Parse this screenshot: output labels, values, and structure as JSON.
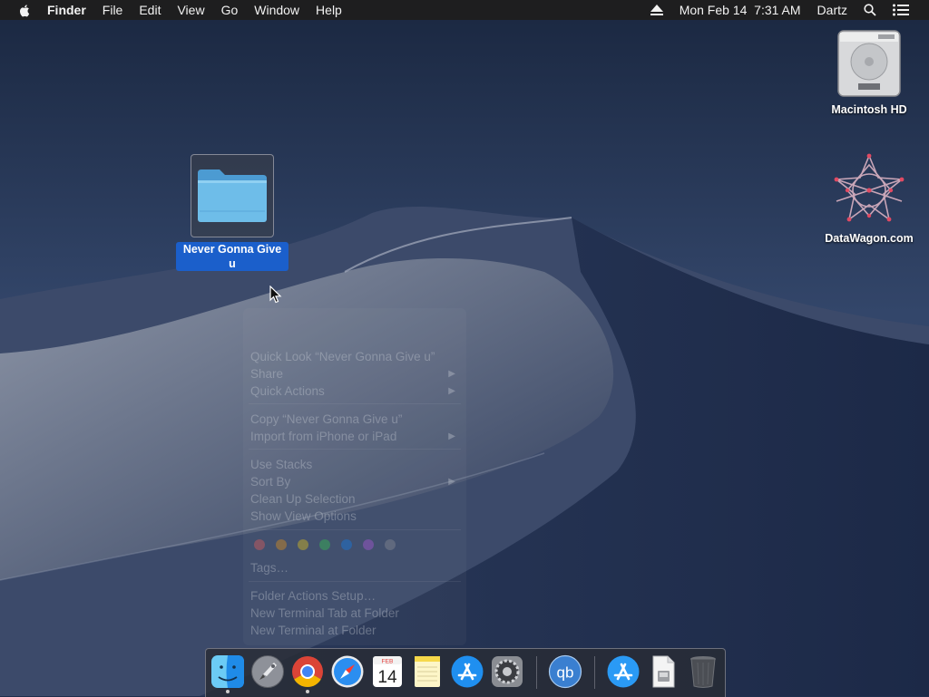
{
  "menubar": {
    "apple_icon": "apple-logo-icon",
    "app_name": "Finder",
    "menus": [
      "File",
      "Edit",
      "View",
      "Go",
      "Window",
      "Help"
    ],
    "datetime": "Mon Feb 14  7:31 AM",
    "user": "Dartz",
    "status_icons": [
      "eject-icon",
      "search-icon",
      "notification-list-icon"
    ]
  },
  "desktop": {
    "icons": [
      {
        "label": "Macintosh HD",
        "icon": "hard-drive-icon"
      },
      {
        "label": "DataWagon.com",
        "icon": "network-volume-icon"
      }
    ],
    "selected_folder": {
      "label": "Never Gonna Give u",
      "icon": "folder-icon"
    }
  },
  "context_menu": {
    "items": {
      "quick_look": "Quick Look “Never Gonna Give u”",
      "share": "Share",
      "quick_actions": "Quick Actions",
      "copy": "Copy “Never Gonna Give u”",
      "import": "Import from iPhone or iPad",
      "use_stacks": "Use Stacks",
      "sort_by": "Sort By",
      "clean_up": "Clean Up Selection",
      "view_options": "Show View Options",
      "tags": "Tags…",
      "folder_actions": "Folder Actions Setup…",
      "terminal_tab": "New Terminal Tab at Folder",
      "terminal": "New Terminal at Folder"
    },
    "tag_colors": [
      "#ff5f57",
      "#ff9f0a",
      "#ffd60a",
      "#32d74b",
      "#0a84ff",
      "#bf5af2",
      "#98989d"
    ]
  },
  "dock": {
    "apps": [
      {
        "name": "Finder",
        "icon": "finder-icon",
        "running": true
      },
      {
        "name": "Launchpad",
        "icon": "launchpad-icon",
        "running": false
      },
      {
        "name": "Google Chrome",
        "icon": "chrome-icon",
        "running": true
      },
      {
        "name": "Safari",
        "icon": "safari-icon",
        "running": false
      },
      {
        "name": "Calendar",
        "icon": "calendar-icon",
        "running": false,
        "month": "FEB",
        "day": "14"
      },
      {
        "name": "Notes",
        "icon": "notes-icon",
        "running": false
      },
      {
        "name": "App Store",
        "icon": "app-store-icon",
        "running": false
      },
      {
        "name": "System Preferences",
        "icon": "system-preferences-icon",
        "running": false
      },
      {
        "name": "qBittorrent",
        "icon": "qbittorrent-icon",
        "running": false,
        "glyph": "qb"
      },
      {
        "name": "App Store Downloads",
        "icon": "app-store-folder-icon",
        "running": false
      },
      {
        "name": "Document",
        "icon": "document-icon",
        "running": false
      },
      {
        "name": "Trash",
        "icon": "trash-icon",
        "running": false
      }
    ]
  },
  "colors": {
    "menubar_bg": "#1e1e1f",
    "selection_blue": "#1b5fcb",
    "folder_blue": "#5fb3e6",
    "sky": "#1f2e4d"
  }
}
